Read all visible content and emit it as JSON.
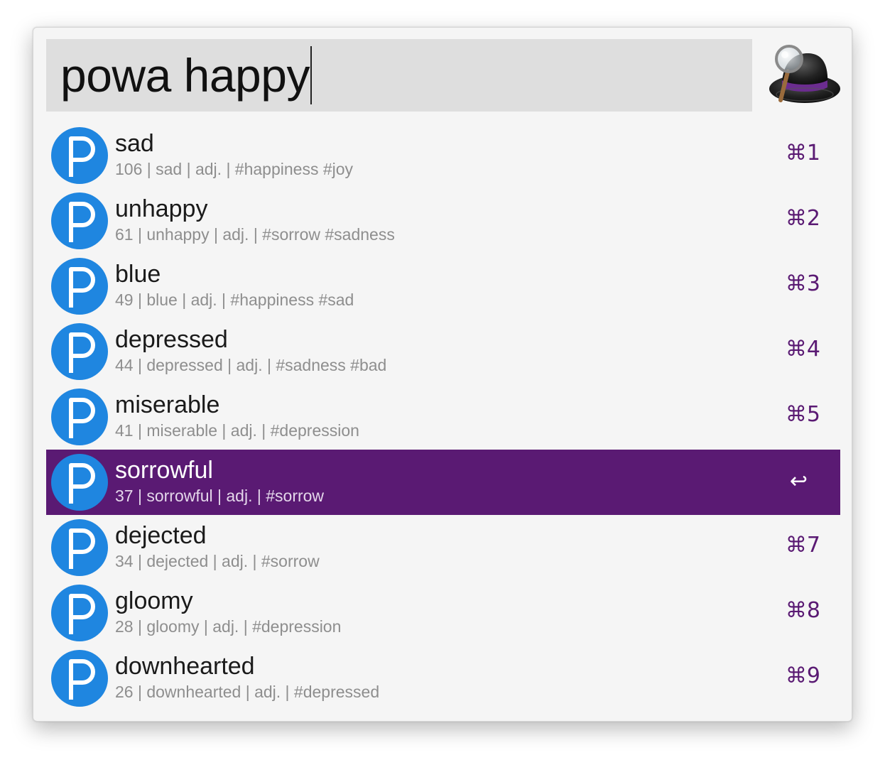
{
  "search": {
    "query": "powa happy"
  },
  "app_icon": "alfred-hat-icon",
  "results": [
    {
      "title": "sad",
      "subtitle": "106 | sad | adj. | #happiness #joy",
      "shortcut": "⌘1",
      "selected": false
    },
    {
      "title": "unhappy",
      "subtitle": "61 | unhappy | adj. | #sorrow #sadness",
      "shortcut": "⌘2",
      "selected": false
    },
    {
      "title": "blue",
      "subtitle": "49 | blue | adj. | #happiness #sad",
      "shortcut": "⌘3",
      "selected": false
    },
    {
      "title": "depressed",
      "subtitle": "44 | depressed | adj. | #sadness #bad",
      "shortcut": "⌘4",
      "selected": false
    },
    {
      "title": "miserable",
      "subtitle": "41 | miserable | adj. | #depression",
      "shortcut": "⌘5",
      "selected": false
    },
    {
      "title": "sorrowful",
      "subtitle": "37 | sorrowful | adj. | #sorrow",
      "shortcut": "↩",
      "selected": true
    },
    {
      "title": "dejected",
      "subtitle": "34 | dejected | adj. | #sorrow",
      "shortcut": "⌘7",
      "selected": false
    },
    {
      "title": "gloomy",
      "subtitle": "28 | gloomy | adj. | #depression",
      "shortcut": "⌘8",
      "selected": false
    },
    {
      "title": "downhearted",
      "subtitle": "26 | downhearted | adj. | #depressed",
      "shortcut": "⌘9",
      "selected": false
    }
  ],
  "colors": {
    "accent": "#5a1a73",
    "result_icon": "#1f86e0",
    "search_field": "#dedede",
    "window": "#f5f5f5"
  }
}
